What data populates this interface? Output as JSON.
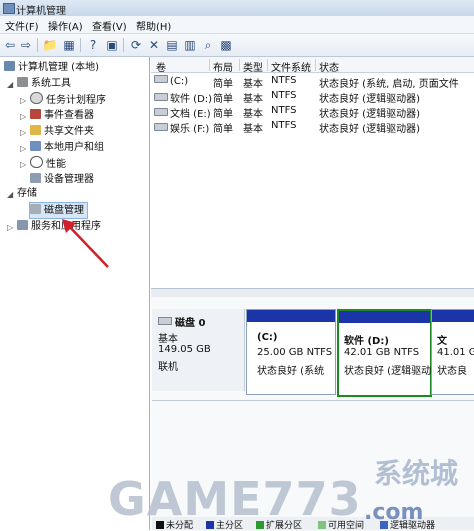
{
  "window": {
    "title": "计算机管理"
  },
  "menu": [
    "文件(F)",
    "操作(A)",
    "查看(V)",
    "帮助(H)"
  ],
  "toolbar": {
    "icons": [
      "back-arrow-icon",
      "forward-arrow-icon",
      "up-folder-icon",
      "show-hide-tree-icon",
      "help-icon",
      "properties-icon",
      "refresh-icon",
      "delete-icon",
      "open-icon",
      "search-icon",
      "zoom-icon",
      "settings-icon"
    ]
  },
  "tree": {
    "root": "计算机管理 (本地)",
    "system_tools": "系统工具",
    "task_scheduler": "任务计划程序",
    "event_viewer": "事件查看器",
    "shared_folders": "共享文件夹",
    "local_users": "本地用户和组",
    "performance": "性能",
    "device_manager": "设备管理器",
    "storage": "存储",
    "disk_management": "磁盘管理",
    "services": "服务和应用程序"
  },
  "volumes": {
    "headers": [
      "卷",
      "布局",
      "类型",
      "文件系统",
      "状态"
    ],
    "rows": [
      {
        "name": "(C:)",
        "layout": "简单",
        "type": "基本",
        "fs": "NTFS",
        "status": "状态良好 (系统, 启动, 页面文件"
      },
      {
        "name": "软件 (D:)",
        "layout": "简单",
        "type": "基本",
        "fs": "NTFS",
        "status": "状态良好 (逻辑驱动器)"
      },
      {
        "name": "文档 (E:)",
        "layout": "简单",
        "type": "基本",
        "fs": "NTFS",
        "status": "状态良好 (逻辑驱动器)"
      },
      {
        "name": "娱乐 (F:)",
        "layout": "简单",
        "type": "基本",
        "fs": "NTFS",
        "status": "状态良好 (逻辑驱动器)"
      }
    ]
  },
  "disk0": {
    "label": "磁盘 0",
    "type": "基本",
    "size": "149.05 GB",
    "status": "联机"
  },
  "partitions": [
    {
      "name": "(C:)",
      "size": "25.00 GB NTFS",
      "status": "状态良好 (系统"
    },
    {
      "name": "软件 (D:)",
      "size": "42.01 GB NTFS",
      "status": "状态良好 (逻辑驱动"
    },
    {
      "name": "文",
      "size": "41.01 G",
      "status": "状态良"
    }
  ],
  "legend": [
    "未分配",
    "主分区",
    "扩展分区",
    "可用空间",
    "逻辑驱动器"
  ],
  "watermark": {
    "text1": "GAME773",
    "text2": "系统城",
    "text3": ".com"
  },
  "colors": {
    "partition_bar": "#1b35a8",
    "selection_green": "#1c8a22",
    "arrow": "#d0202a"
  }
}
